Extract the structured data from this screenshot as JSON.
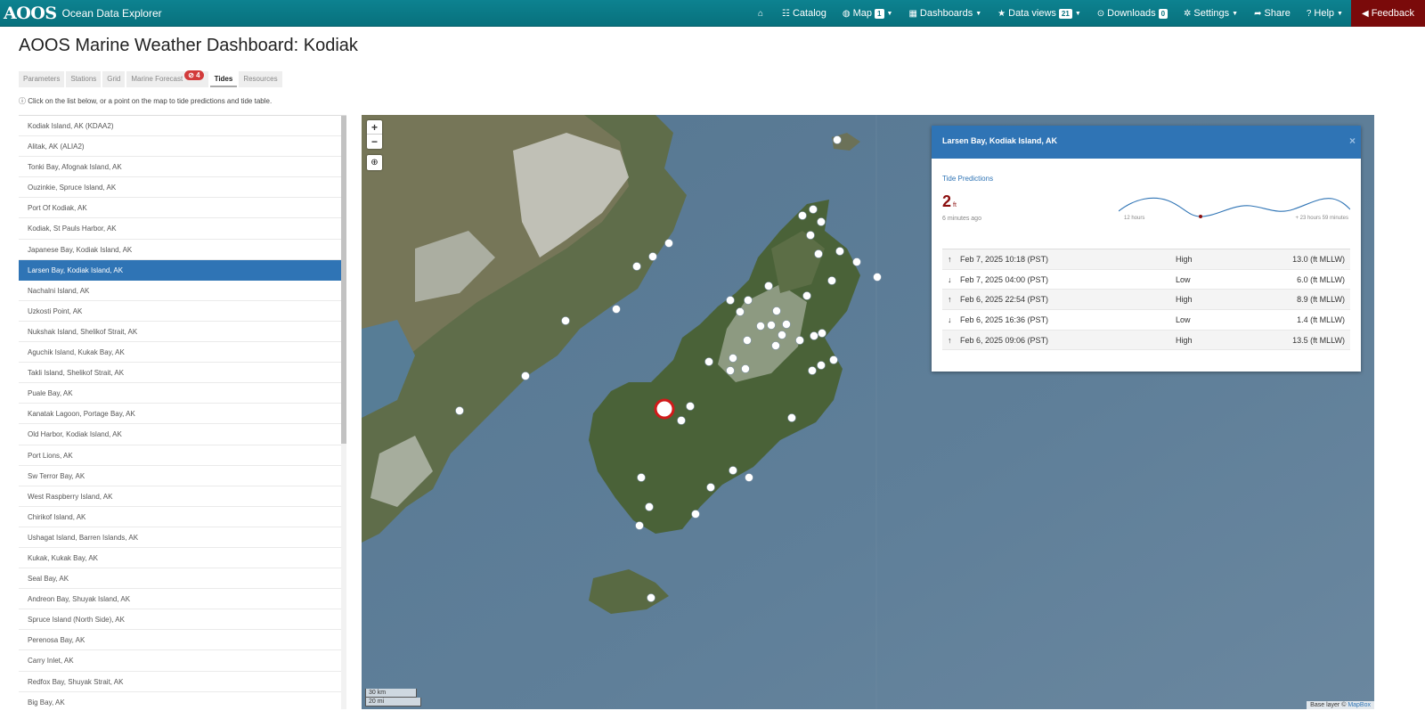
{
  "navbar": {
    "brand_logo": "AOOS",
    "brand_title": "Ocean Data Explorer",
    "items": [
      {
        "icon": "home-icon",
        "glyph": "⌂",
        "label": "",
        "badge": "",
        "caret": false
      },
      {
        "icon": "catalog-icon",
        "glyph": "☷",
        "label": "Catalog",
        "badge": "",
        "caret": false
      },
      {
        "icon": "globe-icon",
        "glyph": "◍",
        "label": "Map",
        "badge": "1",
        "caret": true
      },
      {
        "icon": "dashboard-icon",
        "glyph": "▦",
        "label": "Dashboards",
        "badge": "",
        "caret": true
      },
      {
        "icon": "star-icon",
        "glyph": "★",
        "label": "Data views",
        "badge": "21",
        "caret": true
      },
      {
        "icon": "download-icon",
        "glyph": "⊙",
        "label": "Downloads",
        "badge": "0",
        "caret": false
      },
      {
        "icon": "gear-icon",
        "glyph": "✲",
        "label": "Settings",
        "badge": "",
        "caret": true
      },
      {
        "icon": "share-icon",
        "glyph": "➦",
        "label": "Share",
        "badge": "",
        "caret": false
      },
      {
        "icon": "help-icon",
        "glyph": "?",
        "label": "Help",
        "badge": "",
        "caret": true
      },
      {
        "icon": "megaphone-icon",
        "glyph": "◀",
        "label": "Feedback",
        "badge": "",
        "caret": false
      }
    ]
  },
  "page": {
    "title": "AOOS Marine Weather Dashboard: Kodiak",
    "hint": "Click on the list below, or a point on the map to tide predictions and tide table."
  },
  "tabs": [
    {
      "label": "Parameters",
      "badge": "",
      "active": false
    },
    {
      "label": "Stations",
      "badge": "",
      "active": false
    },
    {
      "label": "Grid",
      "badge": "",
      "active": false
    },
    {
      "label": "Marine Forecast",
      "badge": "4",
      "active": false
    },
    {
      "label": "Tides",
      "badge": "",
      "active": true
    },
    {
      "label": "Resources",
      "badge": "",
      "active": false
    }
  ],
  "stations": [
    "Kodiak Island, AK (KDAA2)",
    "Alitak, AK (ALIA2)",
    "Tonki Bay, Afognak Island, AK",
    "Ouzinkie, Spruce Island, AK",
    "Port Of Kodiak, AK",
    "Kodiak, St Pauls Harbor, AK",
    "Japanese Bay, Kodiak Island, AK",
    "Larsen Bay, Kodiak Island, AK",
    "Nachalni Island, AK",
    "Uzkosti Point, AK",
    "Nukshak Island, Shelikof Strait, AK",
    "Aguchik Island, Kukak Bay, AK",
    "Takli Island, Shelikof Strait, AK",
    "Puale Bay, AK",
    "Kanatak Lagoon, Portage Bay, AK",
    "Old Harbor, Kodiak Island, AK",
    "Port Lions, AK",
    "Sw Terror Bay, AK",
    "West Raspberry Island, AK",
    "Chirikof Island, AK",
    "Ushagat Island, Barren Islands, AK",
    "Kukak, Kukak Bay, AK",
    "Seal Bay, AK",
    "Andreon Bay, Shuyak Island, AK",
    "Spruce Island (North Side), AK",
    "Perenosa Bay, AK",
    "Carry Inlet, AK",
    "Redfox Bay, Shuyak Strait, AK",
    "Big Bay, AK"
  ],
  "selected_station": "Larsen Bay, Kodiak Island, AK",
  "map": {
    "zoom_in": "+",
    "zoom_out": "−",
    "scale_km": "30 km",
    "scale_mi": "20 mi",
    "attribution_prefix": "Base layer ©",
    "attribution_link": "MapBox"
  },
  "popup": {
    "title": "Larsen Bay, Kodiak Island, AK",
    "close": "×",
    "subtitle": "Tide Predictions",
    "current_value": "2",
    "current_unit": "ft",
    "current_age": "6 minutes ago",
    "spark_left": "12 hours",
    "spark_right": "+ 23 hours 59 minutes",
    "rows": [
      {
        "dir": "up",
        "time": "Feb 7, 2025 10:18 (PST)",
        "kind": "High",
        "value": "13.0 (ft MLLW)"
      },
      {
        "dir": "down",
        "time": "Feb 7, 2025 04:00 (PST)",
        "kind": "Low",
        "value": "6.0 (ft MLLW)"
      },
      {
        "dir": "up",
        "time": "Feb 6, 2025 22:54 (PST)",
        "kind": "High",
        "value": "8.9 (ft MLLW)"
      },
      {
        "dir": "down",
        "time": "Feb 6, 2025 16:36 (PST)",
        "kind": "Low",
        "value": "1.4 (ft MLLW)"
      },
      {
        "dir": "up",
        "time": "Feb 6, 2025 09:06 (PST)",
        "kind": "High",
        "value": "13.5 (ft MLLW)"
      }
    ]
  },
  "colors": {
    "navbar": "#0b7480",
    "accent": "#2f74b5",
    "feedback": "#7a0a0a",
    "current_value": "#8b0e0e"
  }
}
